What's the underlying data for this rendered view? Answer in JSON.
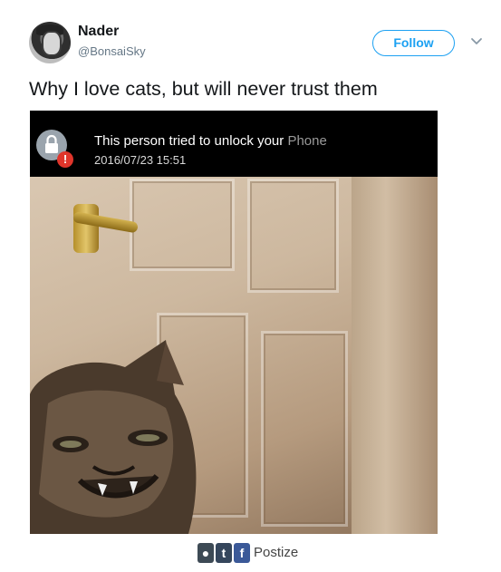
{
  "tweet": {
    "author": {
      "display_name": "Nader",
      "handle": "@BonsaiSky"
    },
    "follow_label": "Follow",
    "text": "Why I love cats, but will never trust them"
  },
  "media": {
    "notification": {
      "title": "This person tried to unlock your ",
      "title_accent": "Phone",
      "timestamp": "2016/07/23 15:51"
    }
  },
  "watermark": {
    "label": "Postize",
    "icons": [
      "camera-icon",
      "tumblr-icon",
      "facebook-icon"
    ]
  },
  "colors": {
    "accent": "#1da1f2",
    "secondary_text": "#657786",
    "alert": "#e0352b"
  }
}
